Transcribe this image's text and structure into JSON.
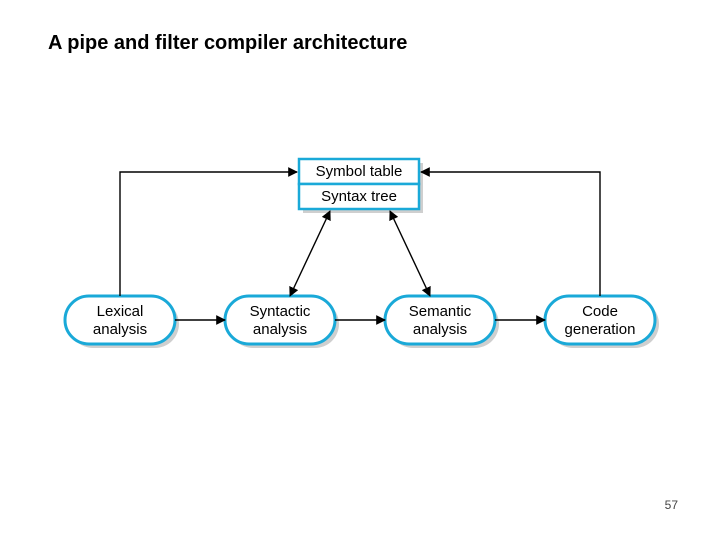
{
  "title": "A pipe and filter compiler architecture",
  "page_number": "57",
  "top": {
    "row1": "Symbol table",
    "row2": "Syntax tree"
  },
  "nodes": {
    "lexical": {
      "line1": "Lexical",
      "line2": "analysis"
    },
    "syntactic": {
      "line1": "Syntactic",
      "line2": "analysis"
    },
    "semantic": {
      "line1": "Semantic",
      "line2": "analysis"
    },
    "codegen": {
      "line1": "Code",
      "line2": "generation"
    }
  }
}
